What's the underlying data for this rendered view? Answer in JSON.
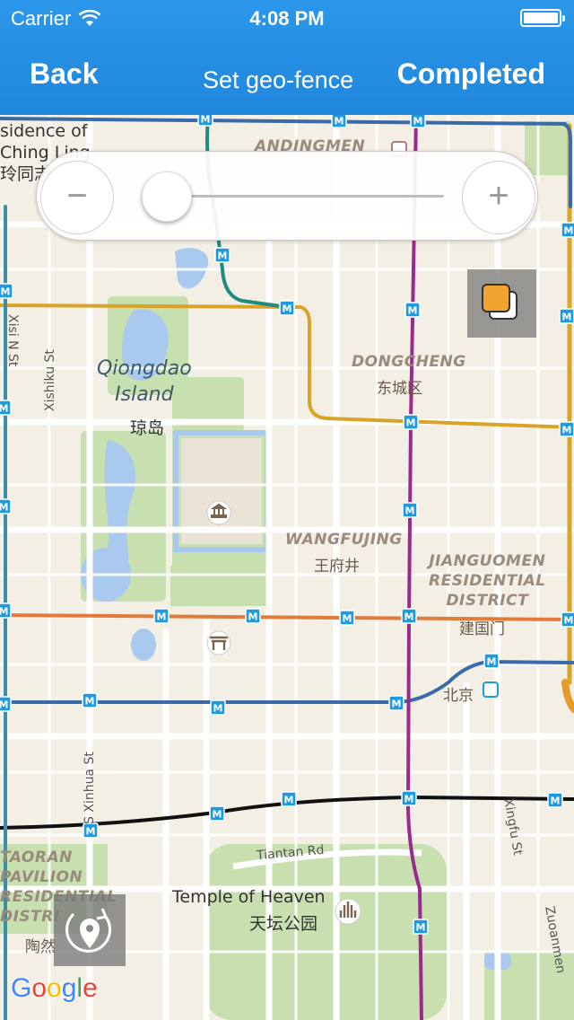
{
  "status_bar": {
    "carrier": "Carrier",
    "time": "4:08 PM"
  },
  "nav": {
    "back_label": "Back",
    "title": "Set geo-fence",
    "done_label": "Completed"
  },
  "zoom": {
    "minus": "−",
    "plus": "+",
    "level": 0.05
  },
  "map": {
    "labels": {
      "residence_1": "sidence of",
      "residence_2": "Ching Ling",
      "residence_cn": "玲同志",
      "andingmen": "ANDINGMEN",
      "dongcheng": "DONGCHENG",
      "dongcheng_cn": "东城区",
      "qiongdao_1": "Qiongdao",
      "qiongdao_2": "Island",
      "qiongdao_cn": "琼岛",
      "xishiku": "Xishiku St",
      "xisi": "Xisi N St",
      "wangfujing": "WANGFUJING",
      "wangfujing_cn": "王府井",
      "jianguomen_1": "JIANGUOMEN",
      "jianguomen_2": "RESIDENTIAL",
      "jianguomen_3": "DISTRICT",
      "jianguomen_cn": "建国门",
      "beijing_cn": "北京",
      "s_xinhua": "S Xinhua St",
      "tiantan_rd": "Tiantan Rd",
      "temple_heaven": "Temple of Heaven",
      "temple_heaven_cn": "天坛公园",
      "taoran_1": "TAORAN",
      "taoran_2": "PAVILION",
      "taoran_3": "RESIDENTIAL",
      "taoran_4": "DISTRI",
      "taoran_cn": "陶然",
      "xingfu": "Xingfu St",
      "zuoanmen": "Zuoanmen"
    },
    "metro_symbol": "M",
    "colors": {
      "nav_bar": "#2090e2",
      "line_orange": "#e07b3c",
      "line_gold": "#d9a327",
      "line_purple": "#9b2a8f",
      "line_blue": "#3a6aa8",
      "line_black": "#111111",
      "line_teal": "#1e8c7e",
      "park": "#c8dfb0",
      "water": "#a9c9ee"
    }
  },
  "google_logo": "Google"
}
